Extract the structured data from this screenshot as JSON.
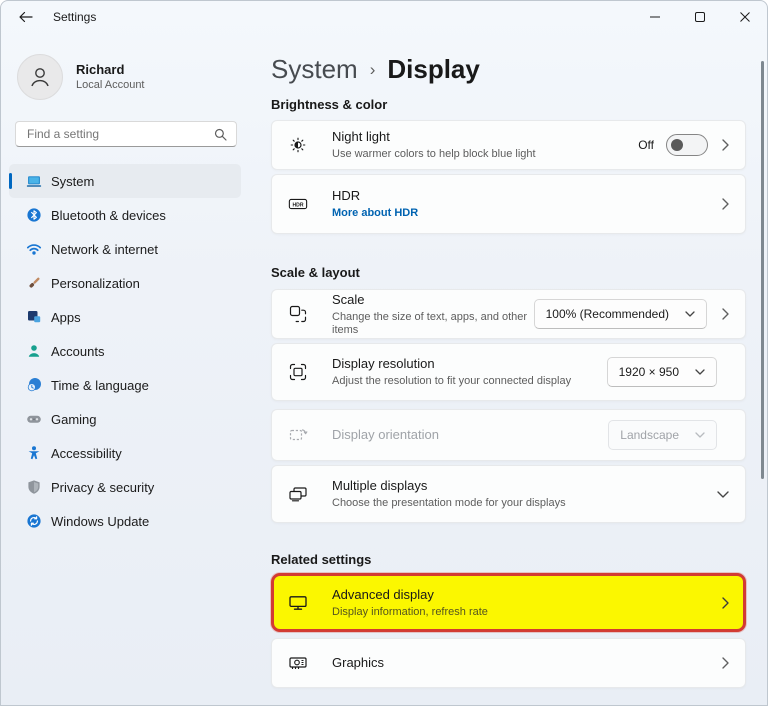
{
  "colors": {
    "accent": "#0067c0",
    "link": "#0063b1",
    "highlight_fill": "#fbf700",
    "highlight_border": "#d23b33",
    "window_bg": "#eef2f8",
    "card_bg": "#fcfdfd"
  },
  "titlebar": {
    "title": "Settings",
    "icons": [
      "back-arrow-icon",
      "minimize-icon",
      "maximize-icon",
      "close-icon"
    ]
  },
  "user": {
    "name": "Richard",
    "account_type": "Local Account",
    "avatar_icon": "person-outline-icon"
  },
  "search": {
    "placeholder": "Find a setting",
    "icon": "magnifier-icon"
  },
  "sidebar": {
    "items": [
      {
        "label": "System",
        "icon": "laptop-icon",
        "selected": true
      },
      {
        "label": "Bluetooth & devices",
        "icon": "bluetooth-icon",
        "selected": false
      },
      {
        "label": "Network & internet",
        "icon": "wifi-icon",
        "selected": false
      },
      {
        "label": "Personalization",
        "icon": "brush-icon",
        "selected": false
      },
      {
        "label": "Apps",
        "icon": "apps-grid-icon",
        "selected": false
      },
      {
        "label": "Accounts",
        "icon": "person-icon",
        "selected": false
      },
      {
        "label": "Time & language",
        "icon": "clock-globe-icon",
        "selected": false
      },
      {
        "label": "Gaming",
        "icon": "gamepad-icon",
        "selected": false
      },
      {
        "label": "Accessibility",
        "icon": "accessibility-person-icon",
        "selected": false
      },
      {
        "label": "Privacy & security",
        "icon": "shield-icon",
        "selected": false
      },
      {
        "label": "Windows Update",
        "icon": "update-arrows-icon",
        "selected": false
      }
    ]
  },
  "breadcrumb": {
    "parent": "System",
    "separator": "›",
    "current": "Display"
  },
  "sections": {
    "brightness": "Brightness & color",
    "scale_layout": "Scale & layout",
    "related": "Related settings"
  },
  "cards": {
    "night_light": {
      "title": "Night light",
      "subtitle": "Use warmer colors to help block blue light",
      "toggle_label": "Off",
      "toggle_state": "off",
      "icon": "night-light-sun-icon"
    },
    "hdr": {
      "title": "HDR",
      "link": "More about HDR",
      "icon": "hdr-badge-icon",
      "icon_text": "HDR"
    },
    "scale": {
      "title": "Scale",
      "subtitle": "Change the size of text, apps, and other items",
      "value": "100% (Recommended)",
      "icon": "scale-resize-icon"
    },
    "resolution": {
      "title": "Display resolution",
      "subtitle": "Adjust the resolution to fit your connected display",
      "value": "1920 × 950",
      "icon": "resolution-brackets-icon"
    },
    "orientation": {
      "title": "Display orientation",
      "value": "Landscape",
      "disabled": true,
      "icon": "rotate-display-icon"
    },
    "multiple_displays": {
      "title": "Multiple displays",
      "subtitle": "Choose the presentation mode for your displays",
      "icon": "dual-monitors-icon"
    },
    "advanced_display": {
      "title": "Advanced display",
      "subtitle": "Display information, refresh rate",
      "icon": "monitor-icon",
      "annotated": true
    },
    "graphics": {
      "title": "Graphics",
      "icon": "gpu-card-icon"
    }
  }
}
